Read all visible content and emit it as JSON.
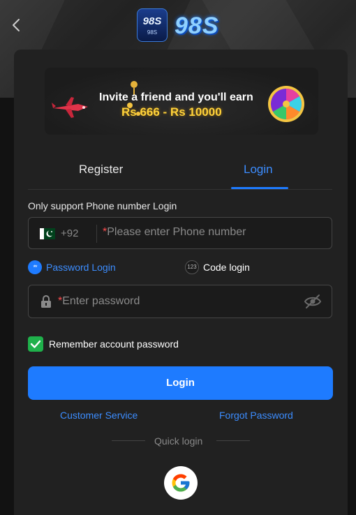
{
  "header": {
    "logo_badge_text": "98S",
    "logo_badge_sub": "98S",
    "logo_text": "98S"
  },
  "banner": {
    "line1": "Invite a friend and you'll earn",
    "line2": "Rs 666 - Rs 10000"
  },
  "tabs": [
    {
      "label": "Register",
      "active": false
    },
    {
      "label": "Login",
      "active": true
    }
  ],
  "login": {
    "hint": "Only support Phone number Login",
    "country_code": "+92",
    "required_mark": "*",
    "phone_placeholder": "Please enter Phone number",
    "mode_password": "Password Login",
    "mode_password_icon_text": "**",
    "mode_code": "Code login",
    "mode_code_icon_text": "123",
    "password_placeholder": "Enter password",
    "remember_label": "Remember account password",
    "remember_checked": true,
    "submit_label": "Login"
  },
  "links": {
    "customer_service": "Customer Service",
    "forgot_password": "Forgot Password"
  },
  "quick_login": {
    "label": "Quick login"
  },
  "colors": {
    "accent": "#1e7bff",
    "link": "#3c8dff",
    "checkbox": "#1fb14b",
    "required": "#ff4d4f",
    "panel": "#212121"
  },
  "icons": {
    "back": "chevron-left-icon",
    "flag": "pakistan-flag-icon",
    "lock": "lock-icon",
    "eye": "eye-off-icon",
    "check": "check-icon",
    "google": "google-icon"
  }
}
